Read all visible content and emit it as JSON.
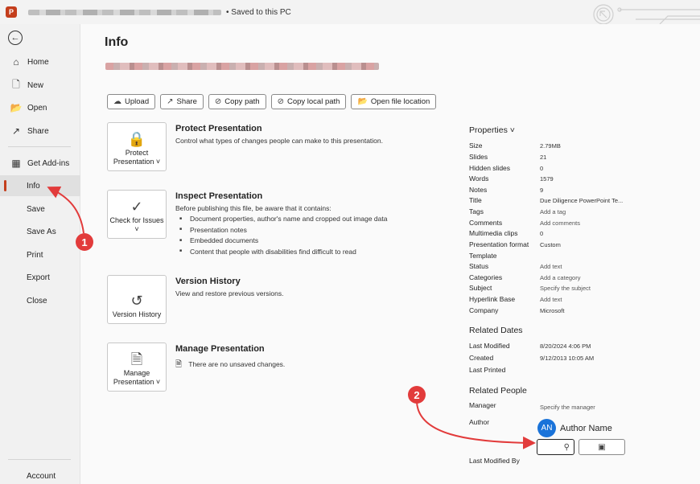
{
  "titlebar": {
    "app_icon": "P",
    "status": "• Saved to this PC"
  },
  "sidebar": {
    "items": [
      {
        "label": "Home",
        "icon": "⌂"
      },
      {
        "label": "New",
        "icon": "🗋"
      },
      {
        "label": "Open",
        "icon": "📂"
      },
      {
        "label": "Share",
        "icon": "↗"
      },
      {
        "label": "Get Add-ins",
        "icon": "▦"
      },
      {
        "label": "Info"
      },
      {
        "label": "Save"
      },
      {
        "label": "Save As"
      },
      {
        "label": "Print"
      },
      {
        "label": "Export"
      },
      {
        "label": "Close"
      },
      {
        "label": "Account"
      }
    ]
  },
  "main": {
    "title": "Info",
    "actions": [
      {
        "label": "Upload",
        "icon": "☁"
      },
      {
        "label": "Share",
        "icon": "↗"
      },
      {
        "label": "Copy path",
        "icon": "⊘"
      },
      {
        "label": "Copy local path",
        "icon": "⊘"
      },
      {
        "label": "Open file location",
        "icon": "📂"
      }
    ],
    "sections": {
      "protect": {
        "tile": "Protect Presentation ˅",
        "tile_icon": "🔒",
        "heading": "Protect Presentation",
        "desc": "Control what types of changes people can make to this presentation."
      },
      "inspect": {
        "tile": "Check for Issues ˅",
        "tile_icon": "✓",
        "heading": "Inspect Presentation",
        "desc": "Before publishing this file, be aware that it contains:",
        "bullets": [
          "Document properties, author's name and cropped out image data",
          "Presentation notes",
          "Embedded documents",
          "Content that people with disabilities find difficult to read"
        ]
      },
      "version": {
        "tile": "Version History",
        "tile_icon": "↺",
        "heading": "Version History",
        "desc": "View and restore previous versions."
      },
      "manage": {
        "tile": "Manage Presentation ˅",
        "tile_icon": "🗎",
        "heading": "Manage Presentation",
        "desc": "There are no unsaved changes.",
        "desc_icon": "🗎"
      }
    }
  },
  "properties": {
    "heading": "Properties ˅",
    "rows": [
      {
        "label": "Size",
        "value": "2.79MB"
      },
      {
        "label": "Slides",
        "value": "21"
      },
      {
        "label": "Hidden slides",
        "value": "0"
      },
      {
        "label": "Words",
        "value": "1579"
      },
      {
        "label": "Notes",
        "value": "9"
      },
      {
        "label": "Title",
        "value": "Due Diligence PowerPoint Te..."
      },
      {
        "label": "Tags",
        "value": "Add a tag"
      },
      {
        "label": "Comments",
        "value": "Add comments"
      },
      {
        "label": "Multimedia clips",
        "value": "0"
      },
      {
        "label": "Presentation format",
        "value": "Custom"
      },
      {
        "label": "Template",
        "value": ""
      },
      {
        "label": "Status",
        "value": "Add text"
      },
      {
        "label": "Categories",
        "value": "Add a category"
      },
      {
        "label": "Subject",
        "value": "Specify the subject"
      },
      {
        "label": "Hyperlink Base",
        "value": "Add text"
      },
      {
        "label": "Company",
        "value": "Microsoft"
      }
    ],
    "dates_heading": "Related Dates",
    "dates": [
      {
        "label": "Last Modified",
        "value": "8/20/2024 4:06 PM"
      },
      {
        "label": "Created",
        "value": "9/12/2013 10:05 AM"
      },
      {
        "label": "Last Printed",
        "value": ""
      }
    ],
    "people_heading": "Related People",
    "manager_label": "Manager",
    "manager_value": "Specify the manager",
    "author_label": "Author",
    "author_initials": "AN",
    "author_name": "Author Name",
    "add_author_icon": "person-add-icon",
    "address_book_icon": "address-book-icon",
    "last_modified_by_label": "Last Modified By"
  },
  "annotations": {
    "badge1": "1",
    "badge2": "2",
    "color": "#e23b3b"
  }
}
